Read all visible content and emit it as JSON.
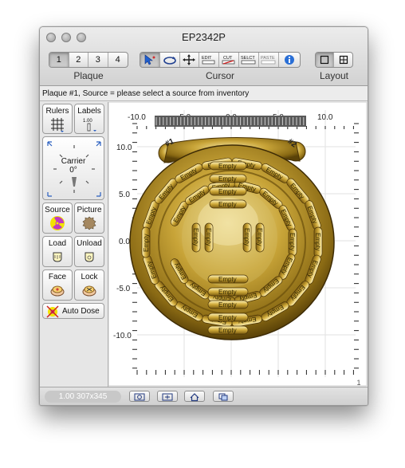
{
  "window": {
    "title": "EP2342P"
  },
  "toolbar": {
    "plaque_tabs": [
      "1",
      "2",
      "3",
      "4"
    ],
    "plaque_label": "Plaque",
    "cursor_label": "Cursor",
    "cursor_tools": [
      "select-arrow-icon",
      "rotate-icon",
      "move-cross-icon",
      "edit-icon",
      "cut-icon",
      "select-icon",
      "paste-icon",
      "info-icon"
    ],
    "cursor_tool_texts": {
      "edit": "EDIT",
      "cut": "CUT",
      "select": "SELCT",
      "paste": "PASTE"
    },
    "layout_label": "Layout"
  },
  "status": {
    "text": "Plaque #1, Source = please select a source from inventory"
  },
  "sidebar": {
    "rulers": "Rulers",
    "labels": "Labels",
    "labels_value": "1.00",
    "carrier": "Carrier",
    "carrier_angle": "0°",
    "source": "Source",
    "picture": "Picture",
    "load": "Load",
    "unload": "Unload",
    "face": "Face",
    "lock": "Lock",
    "auto_dose": "Auto Dose"
  },
  "canvas": {
    "x_ticks": [
      "-10.0",
      "-5.0",
      "0.0",
      "5.0",
      "10.0"
    ],
    "y_ticks": [
      "10.0",
      "5.0",
      "0.0",
      "-5.0",
      "-10.0"
    ],
    "marker1": "#1",
    "marker2": "#2",
    "slot_label": "Empty",
    "page": "1"
  },
  "bottom": {
    "zoom_text": "1.00 307x345"
  },
  "colors": {
    "gold": "#b58f1e",
    "gold_light": "#f2d978",
    "gold_dark": "#5a4208"
  }
}
